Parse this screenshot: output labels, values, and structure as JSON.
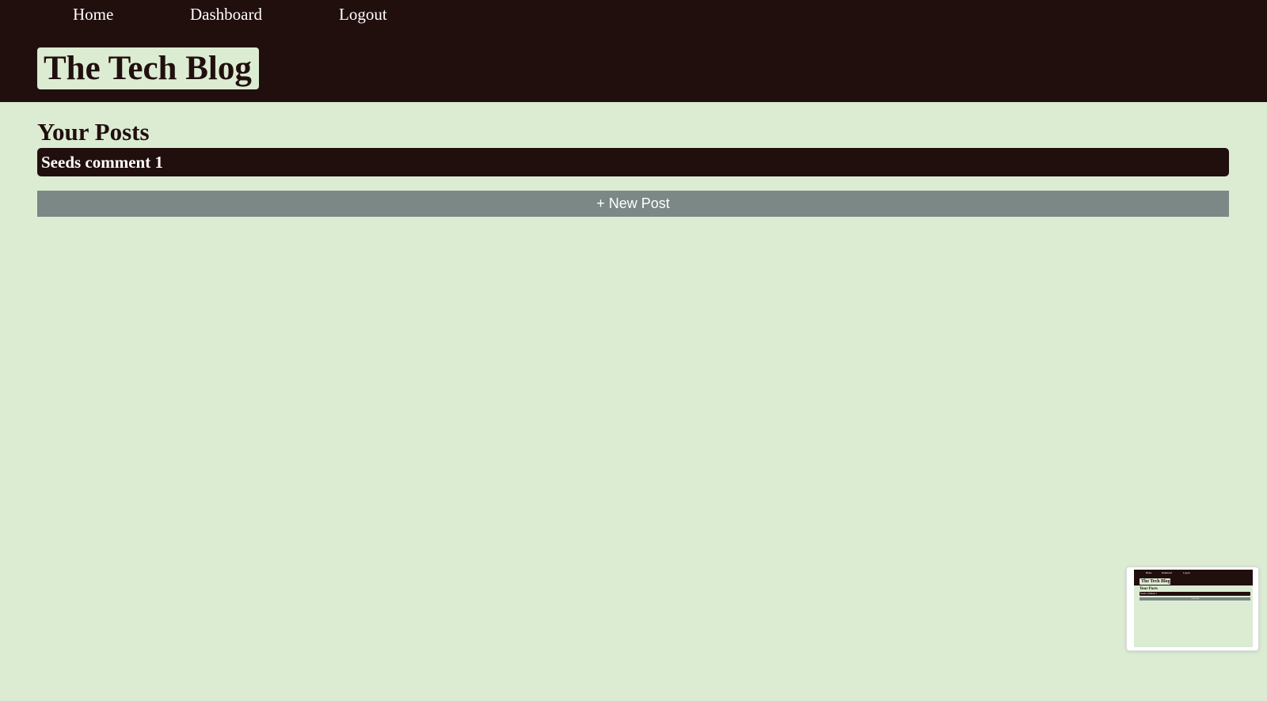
{
  "nav": {
    "home": "Home",
    "dashboard": "Dashboard",
    "logout": "Logout"
  },
  "site": {
    "title": "The Tech Blog"
  },
  "dashboard": {
    "section_title": "Your Posts",
    "posts": [
      {
        "title": "Seeds comment 1"
      }
    ],
    "new_post_label": "+ New Post"
  },
  "colors": {
    "header_bg": "#210f0e",
    "page_bg": "#dcecd3",
    "button_bg": "#7b8886",
    "text_light": "#ffffff"
  }
}
